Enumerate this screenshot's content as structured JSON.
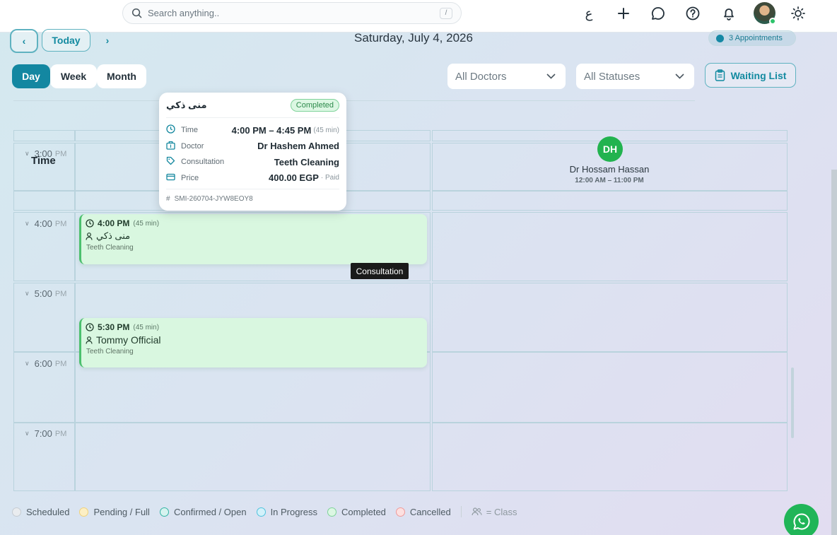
{
  "topbar": {
    "search_placeholder": "Search anything..",
    "search_shortcut": "/",
    "lang_toggle": "ع"
  },
  "toolbar": {
    "today_label": "Today",
    "date_title": "Saturday, July 4, 2026",
    "appointments_badge": "3 Appointments"
  },
  "views": {
    "day": "Day",
    "week": "Week",
    "month": "Month"
  },
  "filters": {
    "doctors": "All Doctors",
    "statuses": "All Statuses",
    "waiting_list": "Waiting List"
  },
  "grid": {
    "time_header": "Time",
    "hours": [
      {
        "h": "3:00",
        "ampm": "PM"
      },
      {
        "h": "4:00",
        "ampm": "PM"
      },
      {
        "h": "5:00",
        "ampm": "PM"
      },
      {
        "h": "6:00",
        "ampm": "PM"
      },
      {
        "h": "7:00",
        "ampm": "PM"
      }
    ]
  },
  "doctor": {
    "initials": "DH",
    "name": "Dr Hossam Hassan",
    "hours": "12:00 AM – 11:00 PM"
  },
  "appointments": [
    {
      "time": "4:00 PM",
      "duration": "(45 min)",
      "patient": "منى ذكي",
      "service": "Teeth Cleaning"
    },
    {
      "time": "5:30 PM",
      "duration": "(45 min)",
      "patient": "Tommy Official",
      "service": "Teeth Cleaning"
    }
  ],
  "tooltip": "Consultation",
  "popover": {
    "patient": "منى ذكي",
    "status": "Completed",
    "time_label": "Time",
    "time_value": "4:00 PM – 4:45 PM",
    "time_sub": "(45 min)",
    "doctor_label": "Doctor",
    "doctor_value": "Dr Hashem Ahmed",
    "consult_label": "Consultation",
    "consult_value": "Teeth Cleaning",
    "price_label": "Price",
    "price_value": "400.00 EGP",
    "price_sub": "· Paid",
    "ref": "SMI-260704-JYW8EOY8"
  },
  "legend": {
    "items": [
      {
        "label": "Scheduled",
        "color": "#e9ecef",
        "border": "#c5ccd2"
      },
      {
        "label": "Pending / Full",
        "color": "#fcefc4",
        "border": "#f0d27a"
      },
      {
        "label": "Confirmed / Open",
        "color": "#d6f3ef",
        "border": "#33b3a4"
      },
      {
        "label": "In Progress",
        "color": "#d3f1fa",
        "border": "#4fc3de"
      },
      {
        "label": "Completed",
        "color": "#dcf7e3",
        "border": "#7fd39a"
      },
      {
        "label": "Cancelled",
        "color": "#fde0e0",
        "border": "#ef9a9a"
      }
    ],
    "class_label": "= Class"
  }
}
